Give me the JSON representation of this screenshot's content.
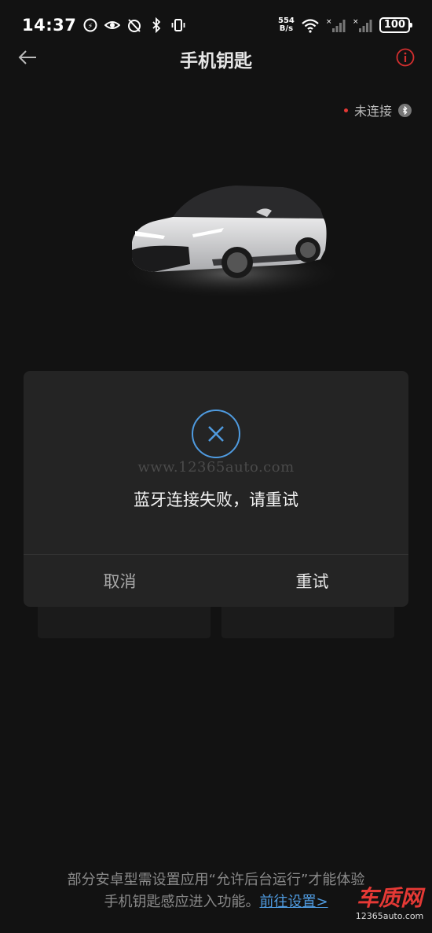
{
  "status_bar": {
    "time": "14:37",
    "net_speed_value": "554",
    "net_speed_unit": "B/s",
    "battery": "100"
  },
  "header": {
    "title": "手机钥匙"
  },
  "connection": {
    "status_text": "未连接"
  },
  "dialog": {
    "watermark": "www.12365auto.com",
    "message": "蓝牙连接失败，请重试",
    "cancel_label": "取消",
    "retry_label": "重试"
  },
  "footer": {
    "note_line1": "部分安卓型需设置应用“允许后台运行”才能体验",
    "note_line2": "手机钥匙感应进入功能。",
    "link_text": "前往设置>"
  },
  "watermark_logo": {
    "main": "车质网",
    "sub": "12365auto.com"
  },
  "colors": {
    "background": "#121212",
    "dialog": "#242424",
    "accent_blue": "#4f9be0",
    "error_red": "#e53935"
  }
}
